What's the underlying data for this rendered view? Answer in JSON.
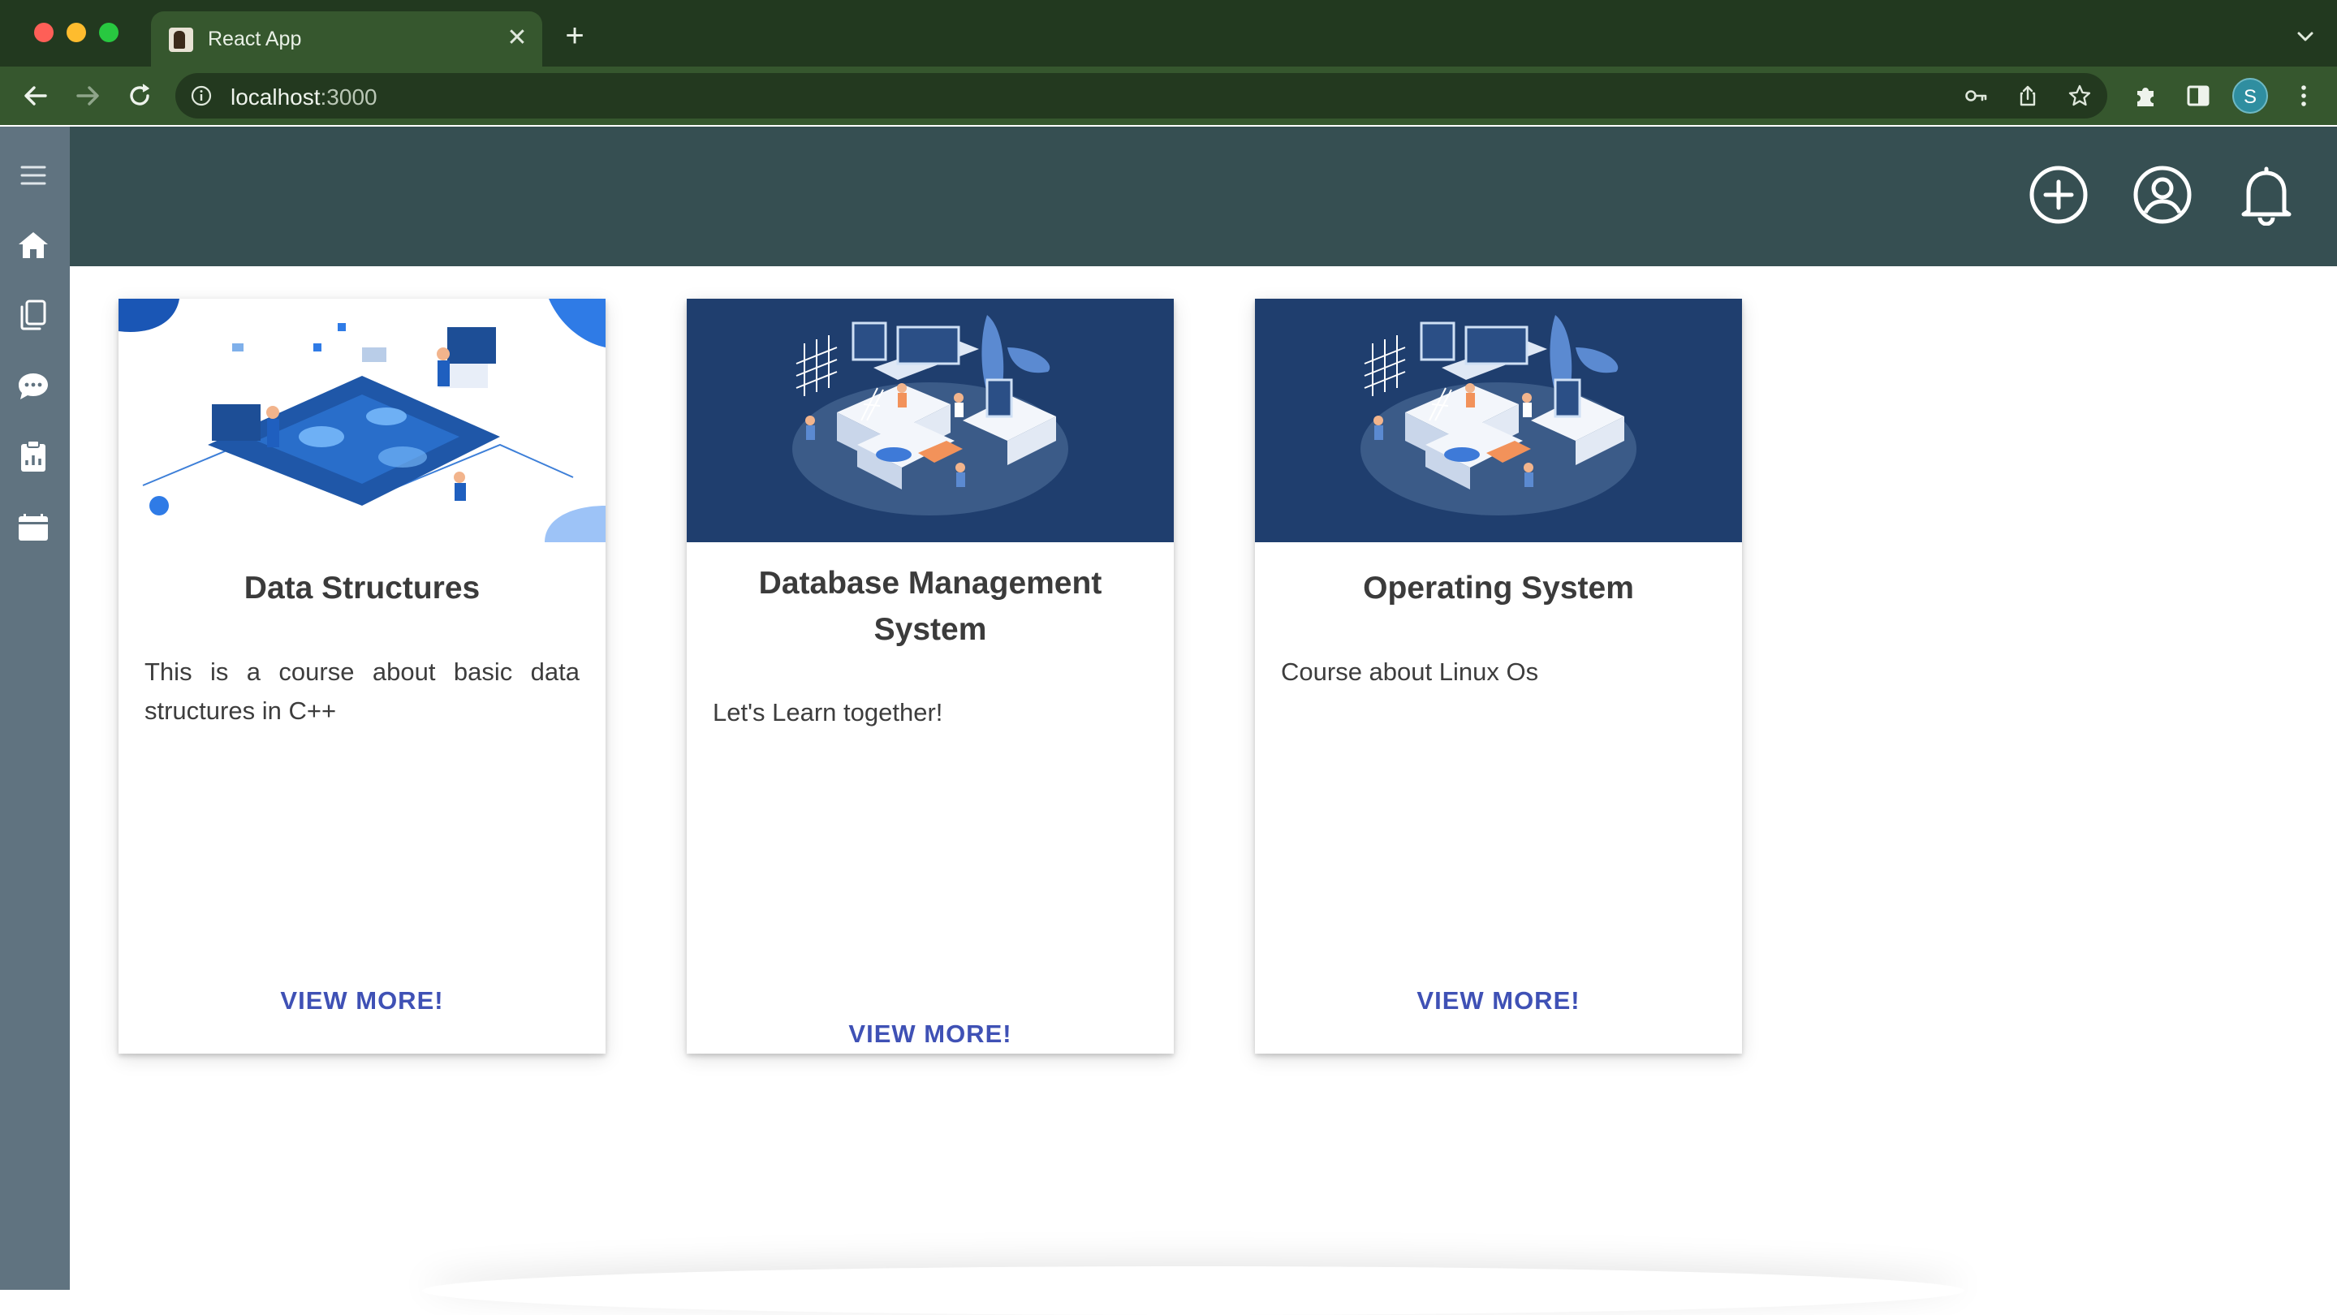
{
  "browser": {
    "tab_title": "React App",
    "address_host": "localhost",
    "address_port": ":3000",
    "profile_initial": "S"
  },
  "icons": {
    "sidebar": [
      "menu-icon",
      "home-icon",
      "courses-icon",
      "chat-icon",
      "clipboard-icon",
      "calendar-icon"
    ],
    "header": [
      "add-circle-icon",
      "account-icon",
      "bell-icon"
    ]
  },
  "colors": {
    "chrome_dark": "#22391f",
    "chrome_toolbar": "#36572e",
    "sidebar": "#607380",
    "header": "#364f52",
    "accent": "#3f51b5",
    "card_media_navy": "#1f3e6e"
  },
  "courses": [
    {
      "title": "Data Structures",
      "description": "This is a course about basic data structures in C++",
      "button": "VIEW MORE!"
    },
    {
      "title": "Database Management System",
      "description": "Let's Learn together!",
      "button": "VIEW MORE!"
    },
    {
      "title": "Operating System",
      "description": "Course about Linux Os",
      "button": "VIEW MORE!"
    }
  ]
}
